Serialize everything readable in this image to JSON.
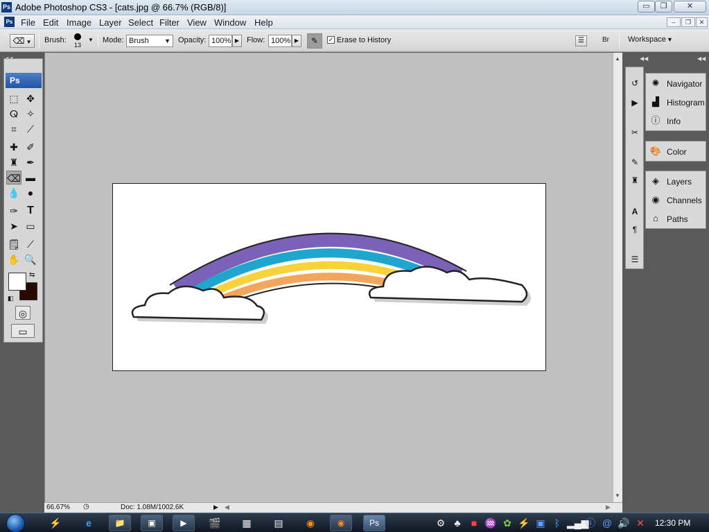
{
  "window": {
    "title": "Adobe Photoshop CS3 - [cats.jpg @ 66.7% (RGB/8)]",
    "logo_text": "Ps",
    "min_glyph": "▭",
    "max_glyph": "❐",
    "close_glyph": "✕"
  },
  "menu": {
    "items": [
      "File",
      "Edit",
      "Image",
      "Layer",
      "Select",
      "Filter",
      "View",
      "Window",
      "Help"
    ],
    "doc_min": "–",
    "doc_restore": "❐",
    "doc_close": "✕"
  },
  "options": {
    "brush_label": "Brush:",
    "brush_size": "13",
    "mode_label": "Mode:",
    "mode_value": "Brush",
    "opacity_label": "Opacity:",
    "opacity_value": "100%",
    "flow_label": "Flow:",
    "flow_value": "100%",
    "erase_history_label": "Erase to History",
    "workspace_label": "Workspace"
  },
  "tools_panel": {
    "header": "Ps"
  },
  "status": {
    "zoom": "66.67%",
    "doc": "Doc: 1.08M/1002.6K"
  },
  "panels": {
    "group1": [
      "Navigator",
      "Histogram",
      "Info"
    ],
    "group2": [
      "Color"
    ],
    "group3": [
      "Layers",
      "Channels",
      "Paths"
    ]
  },
  "taskbar": {
    "clock": "12:30 PM"
  },
  "colors": {
    "foreground": "#ffffff",
    "background": "#2a0a00",
    "rainbow_purple": "#7b62b8",
    "rainbow_blue": "#1fa6cf",
    "rainbow_yellow": "#f7d23a",
    "rainbow_orange": "#f4a55c"
  }
}
